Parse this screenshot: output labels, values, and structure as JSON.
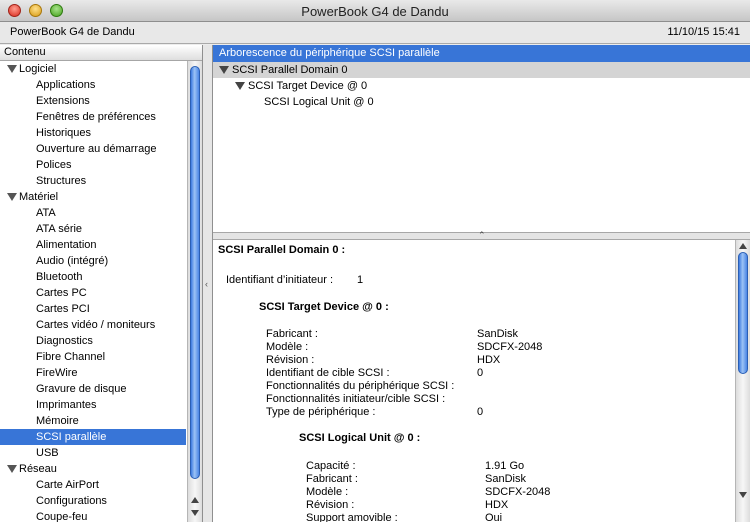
{
  "window": {
    "title": "PowerBook G4 de Dandu"
  },
  "info": {
    "machine": "PowerBook G4 de Dandu",
    "date": "11/10/15 15:41"
  },
  "sidebar": {
    "header": "Contenu",
    "items": [
      {
        "label": "Logiciel",
        "type": "group"
      },
      {
        "label": "Applications",
        "type": "item"
      },
      {
        "label": "Extensions",
        "type": "item"
      },
      {
        "label": "Fenêtres de préférences",
        "type": "item"
      },
      {
        "label": "Historiques",
        "type": "item"
      },
      {
        "label": "Ouverture au démarrage",
        "type": "item"
      },
      {
        "label": "Polices",
        "type": "item"
      },
      {
        "label": "Structures",
        "type": "item"
      },
      {
        "label": "Matériel",
        "type": "group"
      },
      {
        "label": "ATA",
        "type": "item"
      },
      {
        "label": "ATA série",
        "type": "item"
      },
      {
        "label": "Alimentation",
        "type": "item"
      },
      {
        "label": "Audio (intégré)",
        "type": "item"
      },
      {
        "label": "Bluetooth",
        "type": "item"
      },
      {
        "label": "Cartes PC",
        "type": "item"
      },
      {
        "label": "Cartes PCI",
        "type": "item"
      },
      {
        "label": "Cartes vidéo / moniteurs",
        "type": "item"
      },
      {
        "label": "Diagnostics",
        "type": "item"
      },
      {
        "label": "Fibre Channel",
        "type": "item"
      },
      {
        "label": "FireWire",
        "type": "item"
      },
      {
        "label": "Gravure de disque",
        "type": "item"
      },
      {
        "label": "Imprimantes",
        "type": "item"
      },
      {
        "label": "Mémoire",
        "type": "item"
      },
      {
        "label": "SCSI parallèle",
        "type": "item",
        "selected": true
      },
      {
        "label": "USB",
        "type": "item"
      },
      {
        "label": "Réseau",
        "type": "group"
      },
      {
        "label": "Carte AirPort",
        "type": "item"
      },
      {
        "label": "Configurations",
        "type": "item"
      },
      {
        "label": "Coupe-feu",
        "type": "item"
      }
    ]
  },
  "tree": {
    "header": "Arborescence du périphérique SCSI parallèle",
    "nodes": [
      {
        "label": "SCSI Parallel Domain 0",
        "depth": 0,
        "expanded": true
      },
      {
        "label": "SCSI Target Device @ 0",
        "depth": 1,
        "expanded": true
      },
      {
        "label": "SCSI Logical Unit @ 0",
        "depth": 2
      }
    ]
  },
  "detail": {
    "domain_title": "SCSI Parallel Domain 0 :",
    "initiator_label": "Identifiant d’initiateur :",
    "initiator_value": "1",
    "target_title": "SCSI Target Device @ 0 :",
    "target_props": [
      {
        "k": "Fabricant :",
        "v": "SanDisk"
      },
      {
        "k": "Modèle :",
        "v": "SDCFX-2048"
      },
      {
        "k": "Révision :",
        "v": "HDX"
      },
      {
        "k": "Identifiant de cible SCSI :",
        "v": "0"
      },
      {
        "k": "Fonctionnalités du périphérique SCSI :",
        "v": ""
      },
      {
        "k": "Fonctionnalités initiateur/cible SCSI :",
        "v": ""
      },
      {
        "k": "Type de périphérique :",
        "v": "0"
      }
    ],
    "unit_title": "SCSI Logical Unit @ 0 :",
    "unit_props": [
      {
        "k": "Capacité :",
        "v": "1.91 Go"
      },
      {
        "k": "Fabricant :",
        "v": "SanDisk"
      },
      {
        "k": "Modèle :",
        "v": "SDCFX-2048"
      },
      {
        "k": "Révision :",
        "v": "HDX"
      },
      {
        "k": "Support amovible :",
        "v": "Oui"
      }
    ]
  }
}
